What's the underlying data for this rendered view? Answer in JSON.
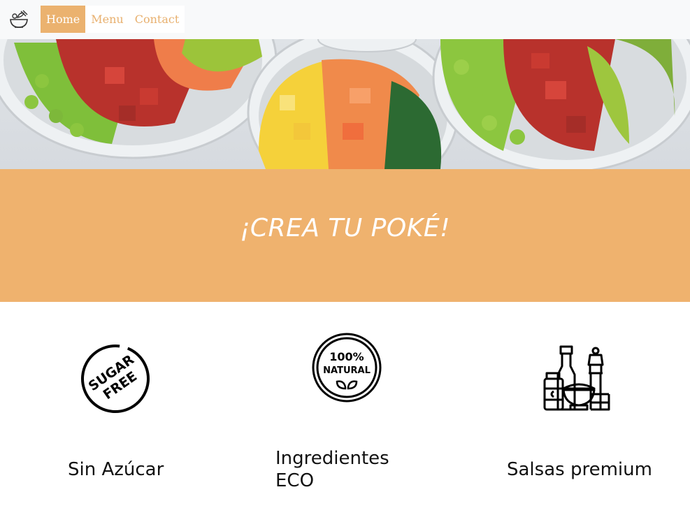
{
  "nav": {
    "logo_icon": "poke-bowl-icon",
    "links": [
      {
        "label": "Home",
        "active": true
      },
      {
        "label": "Menu",
        "active": false
      },
      {
        "label": "Contact",
        "active": false
      }
    ],
    "accent_color": "#ebb26f"
  },
  "hero": {
    "image": "poke-bowls-photo"
  },
  "banner": {
    "title": "¡CREA TU POKÉ!",
    "background_color": "#efb26e"
  },
  "features": [
    {
      "icon": "sugar-free-badge-icon",
      "label": "Sin Azúcar",
      "badge_lines": [
        "SUGAR",
        "FREE"
      ]
    },
    {
      "icon": "natural-badge-icon",
      "label": "Ingredientes ECO",
      "badge_lines": [
        "100%",
        "NATURAL"
      ]
    },
    {
      "icon": "sauces-bottles-icon",
      "label": "Salsas premium"
    }
  ]
}
